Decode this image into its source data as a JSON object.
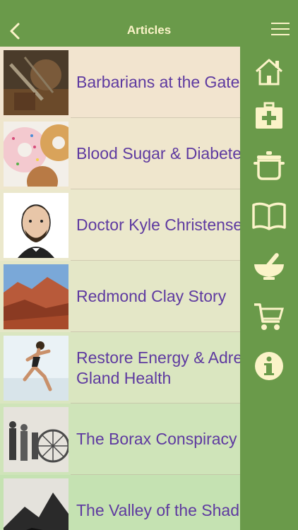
{
  "header": {
    "title": "Articles"
  },
  "articles": [
    {
      "title_lines": [
        "Barbarians at the Gate"
      ],
      "bg": "#f2e4cf"
    },
    {
      "title_lines": [
        "Blood Sugar & Diabetes"
      ],
      "bg": "#efe6cd"
    },
    {
      "title_lines": [
        "Doctor Kyle Christensen"
      ],
      "bg": "#ebe8cc"
    },
    {
      "title_lines": [
        "Redmond Clay Story"
      ],
      "bg": "#e4e7c7"
    },
    {
      "title_lines": [
        "Restore Energy & Adrenal",
        "Gland Health"
      ],
      "bg": "#dae6c0"
    },
    {
      "title_lines": [
        "The Borax Conspiracy"
      ],
      "bg": "#cfe4b9"
    },
    {
      "title_lines": [
        "The Valley of the Shadow"
      ],
      "bg": "#c5e2b2"
    }
  ],
  "side_menu": {
    "items": [
      "home-icon",
      "first-aid-icon",
      "cooking-pot-icon",
      "book-icon",
      "mortar-pestle-icon",
      "cart-icon",
      "info-icon"
    ]
  },
  "colors": {
    "bar": "#6a9a4a",
    "title": "#fbf3c8",
    "link": "#5e3aa0",
    "icon": "#fbf3c8"
  }
}
